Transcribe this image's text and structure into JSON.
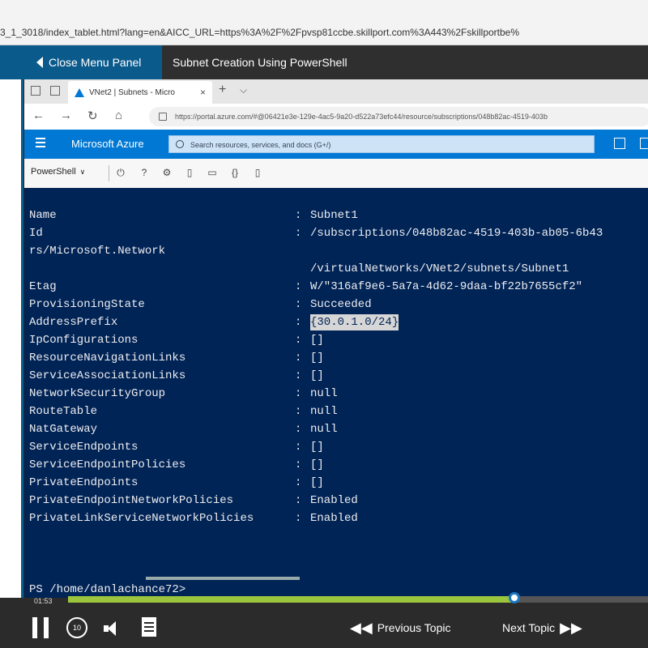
{
  "outer_browser": {
    "url": "3_1_3018/index_tablet.html?lang=en&AICC_URL=https%3A%2F%2Fpvsp81ccbe.skillport.com%3A443%2Fskillportbe%"
  },
  "course_header": {
    "close_menu_label": "Close Menu Panel",
    "title": "Subnet Creation Using PowerShell"
  },
  "inner_browser": {
    "tab_title": "VNet2 | Subnets - Micro",
    "tab_close": "×",
    "new_tab": "+",
    "address": "https://portal.azure.com/#@06421e3e-129e-4ac5-9a20-d522a73efc44/resource/subscriptions/048b82ac-4519-403b",
    "azure_brand": "Microsoft Azure",
    "search_placeholder": "Search resources, services, and docs (G+/)",
    "shell_select": "PowerShell",
    "toolbar_icons": [
      "power-icon",
      "help-icon",
      "settings-icon",
      "upload-icon",
      "folder-icon",
      "braces-icon",
      "preview-icon"
    ]
  },
  "terminal": {
    "lines": [
      {
        "key": "Name",
        "value": "Subnet1"
      },
      {
        "key": "Id",
        "value": "/subscriptions/048b82ac-4519-403b-ab05-6b43"
      },
      {
        "key": "rs/Microsoft.Network",
        "value": ""
      },
      {
        "key": "",
        "value": "/virtualNetworks/VNet2/subnets/Subnet1"
      },
      {
        "key": "Etag",
        "value": "W/\"316af9e6-5a7a-4d62-9daa-bf22b7655cf2\""
      },
      {
        "key": "ProvisioningState",
        "value": "Succeeded"
      },
      {
        "key": "AddressPrefix",
        "value": "{30.0.1.0/24}"
      },
      {
        "key": "IpConfigurations",
        "value": "[]"
      },
      {
        "key": "ResourceNavigationLinks",
        "value": "[]"
      },
      {
        "key": "ServiceAssociationLinks",
        "value": "[]"
      },
      {
        "key": "NetworkSecurityGroup",
        "value": "null"
      },
      {
        "key": "RouteTable",
        "value": "null"
      },
      {
        "key": "NatGateway",
        "value": "null"
      },
      {
        "key": "ServiceEndpoints",
        "value": "[]"
      },
      {
        "key": "ServiceEndpointPolicies",
        "value": "[]"
      },
      {
        "key": "PrivateEndpoints",
        "value": "[]"
      },
      {
        "key": "PrivateEndpointNetworkPolicies",
        "value": "Enabled"
      },
      {
        "key": "PrivateLinkServiceNetworkPolicies",
        "value": "Enabled"
      }
    ],
    "colon": ":",
    "prompt": "PS /home/danlachance72>"
  },
  "player": {
    "time": "01:53",
    "progress_fraction": 0.77,
    "previous_label": "Previous Topic",
    "next_label": "Next Topic",
    "replay_label": "10",
    "progress_color": "#9bc53d",
    "accent": "#0b5a8c"
  }
}
